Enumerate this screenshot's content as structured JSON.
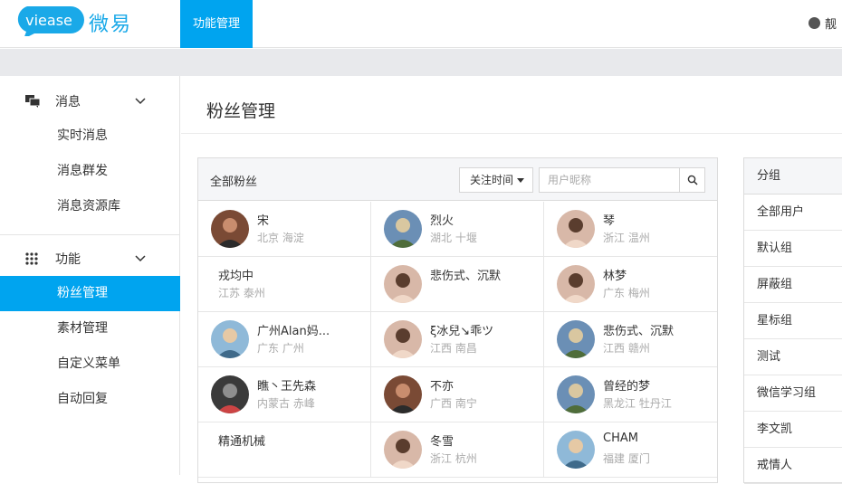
{
  "header": {
    "logo_text": "viease",
    "brand_cn": "微易",
    "nav_active": "功能管理",
    "user_name": "靓",
    "accent": "#00a4ef"
  },
  "sidebar": {
    "groups": [
      {
        "label": "消息",
        "icon": "chat-bubbles-icon",
        "items": [
          "实时消息",
          "消息群发",
          "消息资源库"
        ]
      },
      {
        "label": "功能",
        "icon": "grid-dots-icon",
        "items": [
          "粉丝管理",
          "素材管理",
          "自定义菜单",
          "自动回复"
        ]
      }
    ],
    "active_item": "粉丝管理"
  },
  "main": {
    "title": "粉丝管理",
    "fans": {
      "header_title": "全部粉丝",
      "sort_label": "关注时间",
      "search_placeholder": "用户昵称",
      "items": [
        {
          "name": "宋",
          "location": "北京 海淀",
          "avatar": "avatar-man-icon"
        },
        {
          "name": "烈火",
          "location": "湖北 十堰",
          "avatar": "avatar-photo-icon"
        },
        {
          "name": "琴",
          "location": "浙江 温州",
          "avatar": "avatar-woman-icon"
        },
        {
          "name": "戎均中",
          "location": "江苏 泰州",
          "avatar": ""
        },
        {
          "name": "悲伤式、沉默",
          "location": "",
          "avatar": "avatar-woman-icon"
        },
        {
          "name": "林梦",
          "location": "广东 梅州",
          "avatar": "avatar-woman-icon"
        },
        {
          "name": "广州Alan妈...",
          "location": "广东 广州",
          "avatar": "avatar-child-icon"
        },
        {
          "name": "ξ冰兒↘乖ツ",
          "location": "江西 南昌",
          "avatar": "avatar-woman-icon"
        },
        {
          "name": "悲伤式、沉默",
          "location": "江西 赣州",
          "avatar": "avatar-photo-icon"
        },
        {
          "name": "瞧丶王先森",
          "location": "内蒙古 赤峰",
          "avatar": "avatar-cat-icon"
        },
        {
          "name": "不亦",
          "location": "广西 南宁",
          "avatar": "avatar-man-icon"
        },
        {
          "name": "曾经的梦",
          "location": "黑龙江 牡丹江",
          "avatar": "avatar-photo-icon"
        },
        {
          "name": "精通机械",
          "location": "",
          "avatar": ""
        },
        {
          "name": "冬雪",
          "location": "浙江 杭州",
          "avatar": "avatar-woman-icon"
        },
        {
          "name": "CHAM",
          "location": "福建 厦门",
          "avatar": "avatar-child-icon"
        }
      ]
    },
    "groups": {
      "header_title": "分组",
      "items": [
        "全部用户",
        "默认组",
        "屏蔽组",
        "星标组",
        "测试",
        "微信学习组",
        "李文凯",
        "戒情人"
      ]
    }
  }
}
